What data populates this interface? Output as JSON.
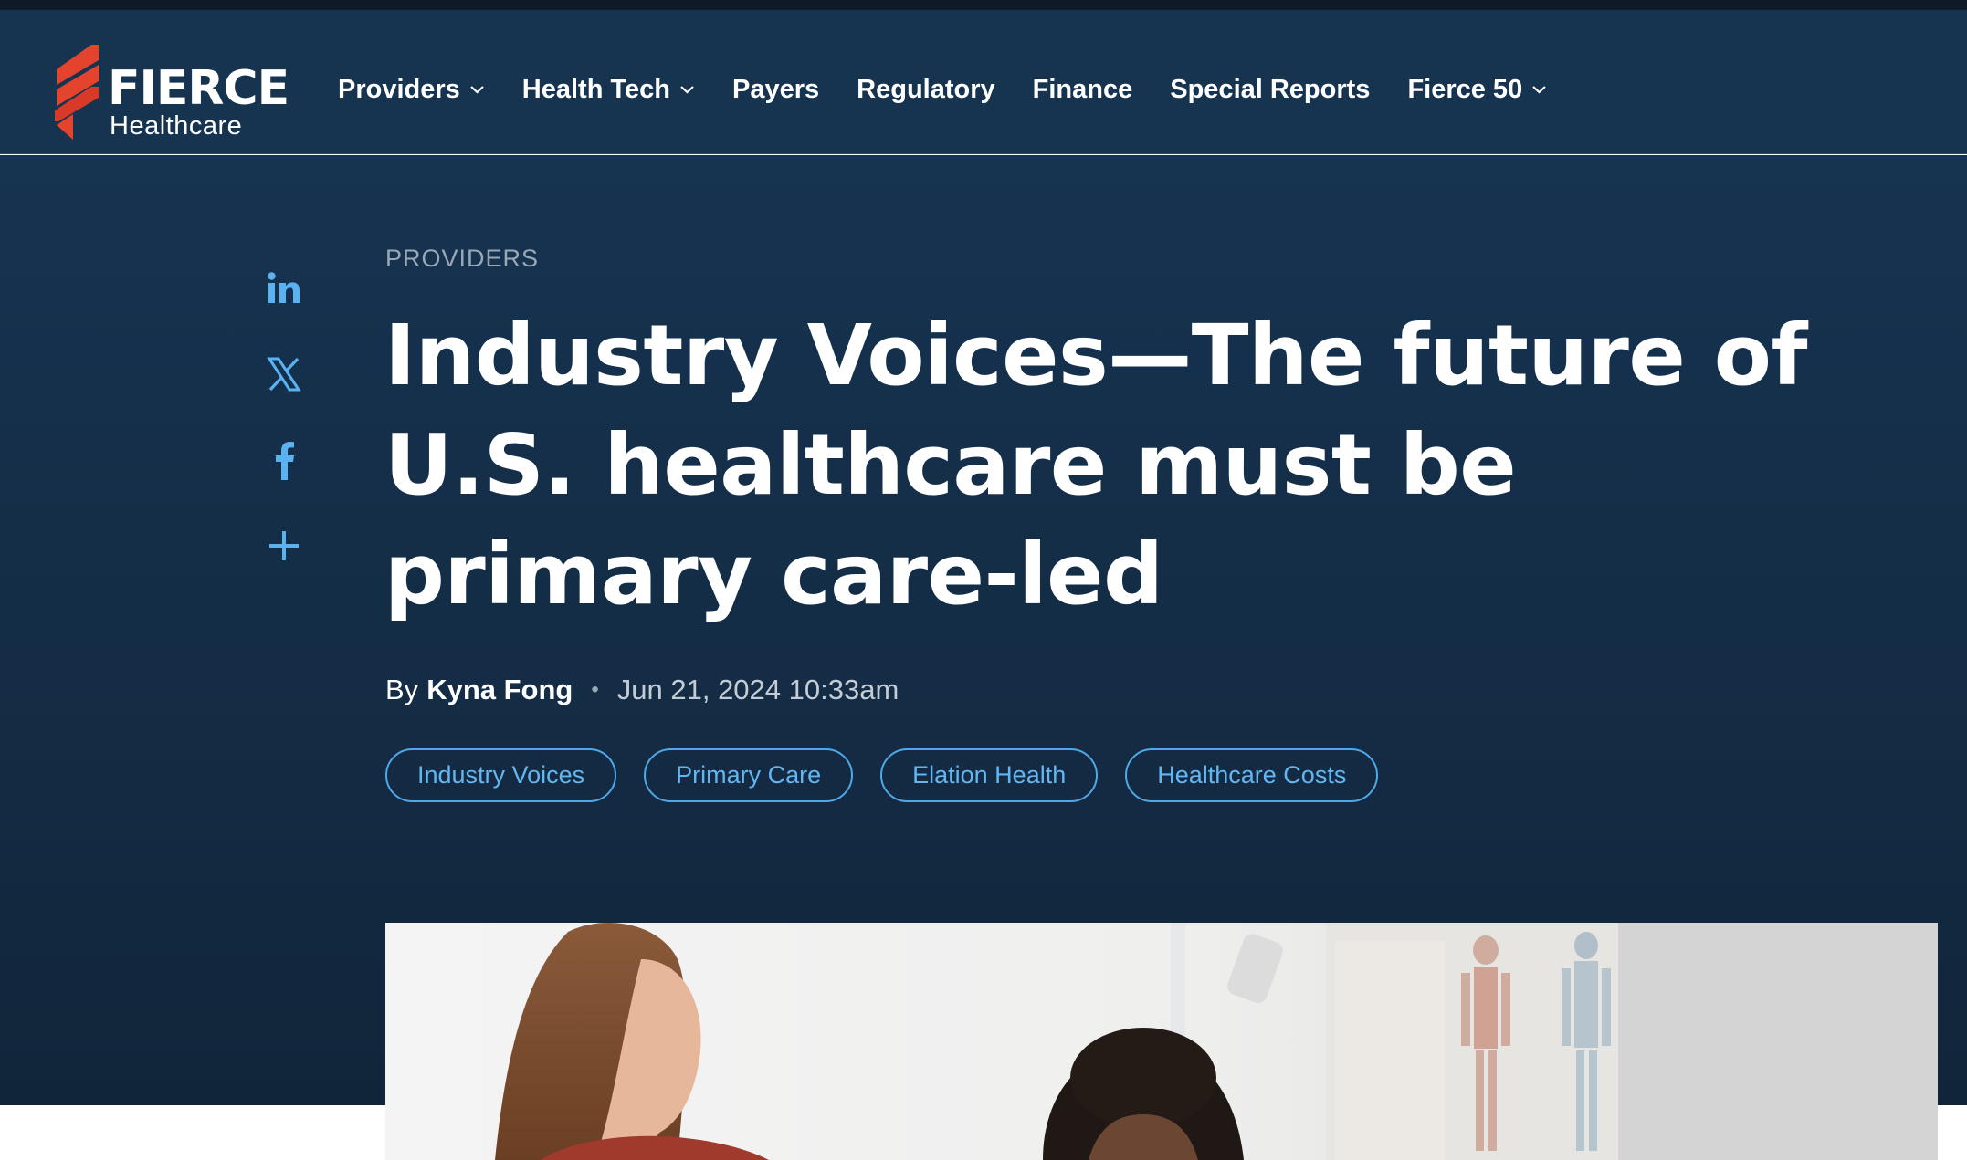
{
  "brand": {
    "name": "FIERCE",
    "subtitle": "Healthcare",
    "logo_colors": [
      "#e4432d",
      "#c73222"
    ]
  },
  "nav": {
    "items": [
      {
        "label": "Providers",
        "has_dropdown": true
      },
      {
        "label": "Health Tech",
        "has_dropdown": true
      },
      {
        "label": "Payers",
        "has_dropdown": false
      },
      {
        "label": "Regulatory",
        "has_dropdown": false
      },
      {
        "label": "Finance",
        "has_dropdown": false
      },
      {
        "label": "Special Reports",
        "has_dropdown": false
      },
      {
        "label": "Fierce 50",
        "has_dropdown": true
      }
    ]
  },
  "share": {
    "icons": [
      "linkedin-icon",
      "x-icon",
      "facebook-icon",
      "plus-icon"
    ],
    "color": "#5ab2f0"
  },
  "article": {
    "kicker": "PROVIDERS",
    "headline": "Industry Voices—The future of U.S. healthcare must be primary care-led",
    "byline_prefix": "By",
    "author": "Kyna Fong",
    "separator": "•",
    "date": "Jun 21, 2024 10:33am",
    "tags": [
      "Industry Voices",
      "Primary Care",
      "Elation Health",
      "Healthcare Costs"
    ],
    "image_alt": "Patient consulting with a doctor in an exam room"
  },
  "colors": {
    "header_bg": "#163350",
    "hero_bg": "#142c45",
    "tag_accent": "#4fa8e8",
    "text": "#ffffff"
  }
}
